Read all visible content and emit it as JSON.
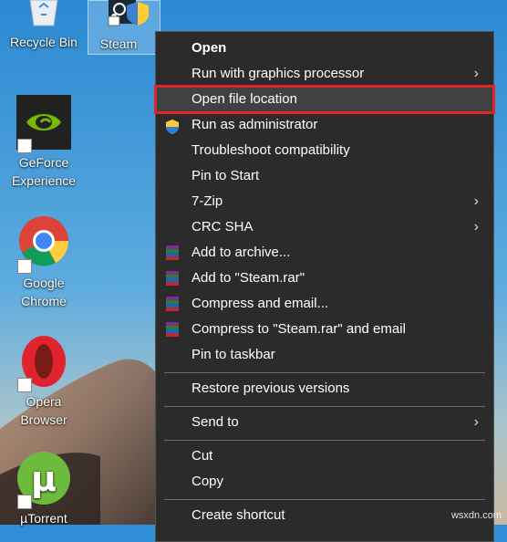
{
  "desktop": {
    "icons": [
      {
        "label": "Recycle Bin"
      },
      {
        "label": "Steam"
      },
      {
        "label": "GeForce Experience"
      },
      {
        "label": "Google Chrome"
      },
      {
        "label": "Opera Browser"
      },
      {
        "label": "µTorrent"
      }
    ]
  },
  "context_menu": {
    "items": [
      {
        "label": "Open",
        "bold": true
      },
      {
        "label": "Run with graphics processor",
        "submenu": true
      },
      {
        "label": "Open file location",
        "highlighted": true
      },
      {
        "label": "Run as administrator",
        "icon": "uac-shield-icon"
      },
      {
        "label": "Troubleshoot compatibility"
      },
      {
        "label": "Pin to Start"
      },
      {
        "label": "7-Zip",
        "submenu": true
      },
      {
        "label": "CRC SHA",
        "submenu": true
      },
      {
        "label": "Add to archive...",
        "icon": "winrar-icon"
      },
      {
        "label": "Add to \"Steam.rar\"",
        "icon": "winrar-icon"
      },
      {
        "label": "Compress and email...",
        "icon": "winrar-icon"
      },
      {
        "label": "Compress to \"Steam.rar\" and email",
        "icon": "winrar-icon"
      },
      {
        "label": "Pin to taskbar"
      },
      {
        "label": "Restore previous versions"
      },
      {
        "label": "Send to",
        "submenu": true
      },
      {
        "label": "Cut"
      },
      {
        "label": "Copy"
      },
      {
        "label": "Create shortcut"
      }
    ],
    "submenu_glyph": "›"
  },
  "colors": {
    "menu_bg": "#2b2b2b",
    "highlight_bg": "#414141",
    "highlight_outline": "#e2232a",
    "separator": "#6b6b6b"
  },
  "watermark": "wsxdn.com"
}
